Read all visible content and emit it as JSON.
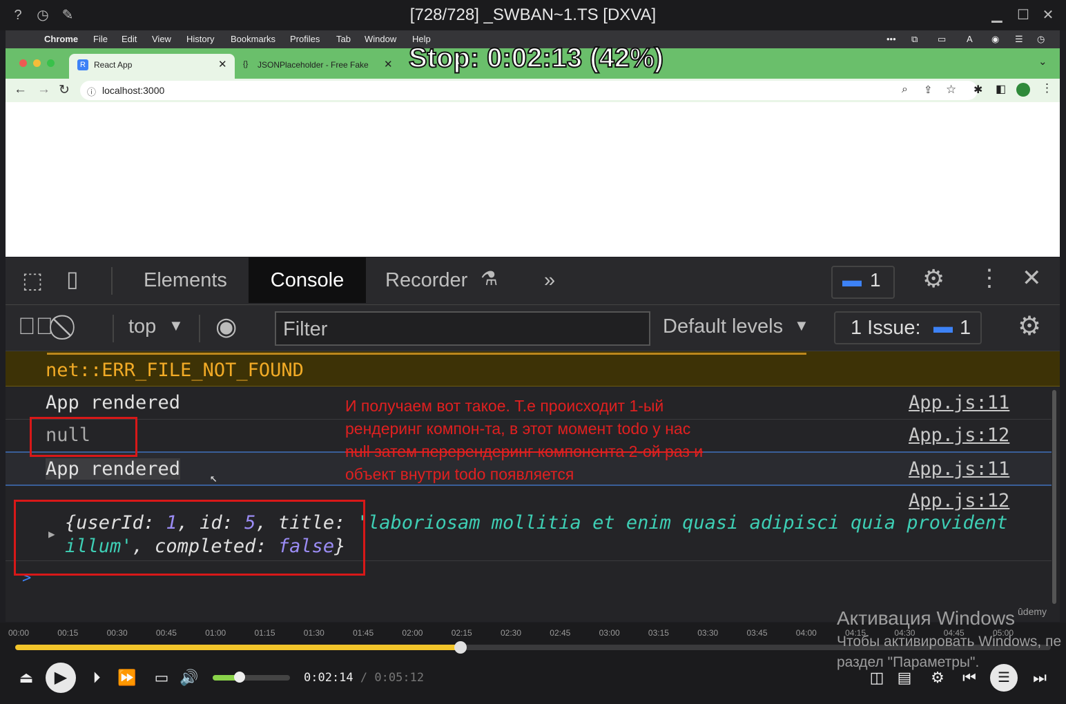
{
  "player": {
    "title": "[728/728] _SWBAN~1.TS [DXVA]",
    "osd": "Stop: 0:02:13 (42%)",
    "current_time": "0:02:14",
    "time_sep": "/",
    "total_time": "0:05:12",
    "progress": 0.43,
    "volume": 0.35,
    "ticks": [
      "00:00",
      "00:15",
      "00:30",
      "00:45",
      "01:00",
      "01:15",
      "01:30",
      "01:45",
      "02:00",
      "02:15",
      "02:30",
      "02:45",
      "03:00",
      "03:15",
      "03:30",
      "03:45",
      "04:00",
      "04:15",
      "04:30",
      "04:45",
      "05:00"
    ]
  },
  "menubar": {
    "items": [
      "Chrome",
      "File",
      "Edit",
      "View",
      "History",
      "Bookmarks",
      "Profiles",
      "Tab",
      "Window",
      "Help"
    ]
  },
  "browser": {
    "tabs": [
      {
        "label": "React App",
        "icon": "R"
      },
      {
        "label": "JSONPlaceholder - Free Fake",
        "icon": "{}"
      }
    ],
    "url": "localhost:3000"
  },
  "devtools": {
    "tabs": [
      "Elements",
      "Console",
      "Recorder"
    ],
    "more": "»",
    "messages_badge": "1",
    "context": "top",
    "filter_placeholder": "Filter",
    "levels": "Default levels",
    "issues_label": "1 Issue:",
    "issues_count": "1"
  },
  "console": {
    "error_top": "net::ERR_FILE_NOT_FOUND",
    "rows": [
      {
        "text": "App rendered",
        "source": "App.js:11"
      },
      {
        "text": "null",
        "source": "App.js:12"
      },
      {
        "text": "App rendered",
        "source": "App.js:11"
      },
      {
        "source": "App.js:12"
      }
    ],
    "object_line1": {
      "p1": "{userId: ",
      "v1": "1",
      "p2": ", id: ",
      "v2": "5",
      "p3": ", title: ",
      "s1": "'laboriosam mollitia et enim quasi adipisci quia provident"
    },
    "object_line2": {
      "s2": "illum'",
      "p4": ", completed: ",
      "v3": "false",
      "p5": "}"
    },
    "prompt": ">"
  },
  "annotation": {
    "lines": [
      "И получаем вот такое. Т.е происходит 1-ый",
      "рендеринг компон-та, в этот момент todo у нас",
      "null затем перерендеринг компонента 2-ой раз и",
      "объект внутри todo появляется"
    ]
  },
  "watermarks": {
    "udemy": "ûdemy",
    "win_line1": "Активация Windows",
    "win_line2": "Чтобы активировать Windows, пе",
    "win_line3": "раздел \"Параметры\"."
  },
  "colors": {
    "tab_strip": "#6abf6b",
    "warning_bg": "#3d3206",
    "warning_text": "#f2ab26",
    "annotation": "#e02020",
    "progress": "#f2c52a",
    "badge_blue": "#3d82f6"
  }
}
